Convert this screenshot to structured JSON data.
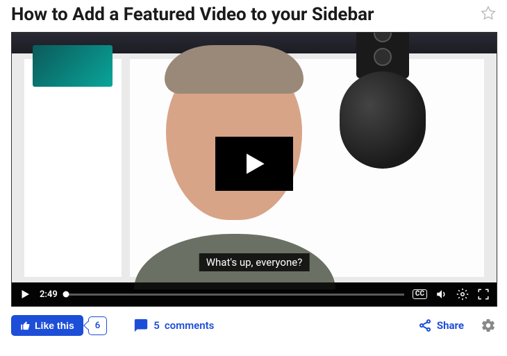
{
  "header": {
    "title": "How to Add a Featured Video to your Sidebar"
  },
  "video": {
    "caption": "What's up, everyone?",
    "duration": "2:49",
    "cc_label": "CC"
  },
  "actions": {
    "like_label": "Like this",
    "like_count": "6",
    "comments_count": "5",
    "comments_label": "comments",
    "share_label": "Share"
  },
  "colors": {
    "primary": "#1d4ed8"
  }
}
